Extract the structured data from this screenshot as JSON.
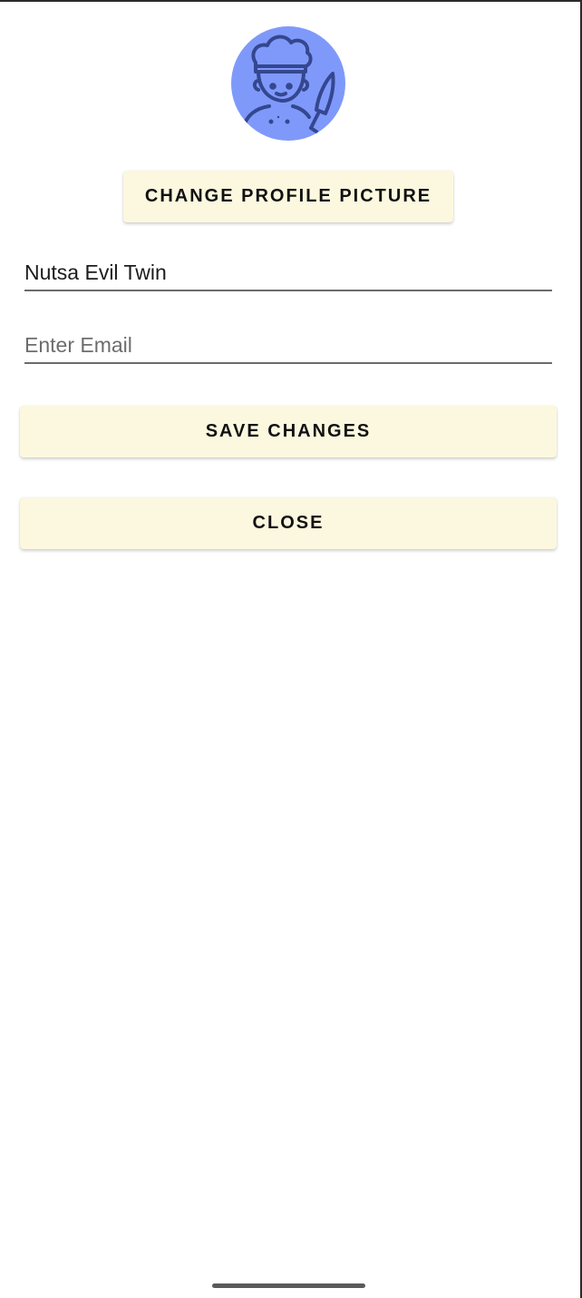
{
  "profile": {
    "avatar_icon": "chef-with-knife-icon",
    "avatar_bg": "#7f99fb",
    "avatar_stroke": "#34478f",
    "change_picture_label": "CHANGE PROFILE PICTURE"
  },
  "form": {
    "name_value": "Nutsa Evil Twin",
    "email_value": "",
    "email_placeholder": "Enter Email"
  },
  "actions": {
    "save_label": "SAVE CHANGES",
    "close_label": "CLOSE"
  },
  "colors": {
    "button_bg": "#fbf8df",
    "underline": "#6b6b6b"
  },
  "system": {
    "home_indicator": "home-indicator-bar"
  }
}
